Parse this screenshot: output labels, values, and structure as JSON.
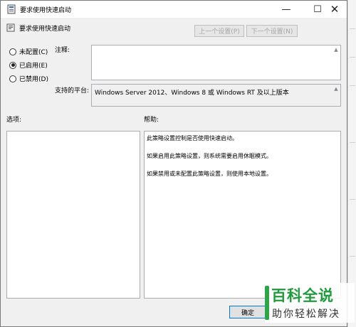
{
  "window": {
    "title": "要求使用快速启动",
    "minimize_glyph": "—",
    "maximize_glyph": "☐",
    "close_glyph": "✕"
  },
  "header": {
    "policy_name": "要求使用快速启动",
    "prev_setting_label": "上一个设置(P)",
    "next_setting_label": "下一个设置(N)"
  },
  "state": {
    "options": [
      {
        "label": "未配置(C)",
        "selected": false
      },
      {
        "label": "已启用(E)",
        "selected": true
      },
      {
        "label": "已禁用(D)",
        "selected": false
      }
    ]
  },
  "comment": {
    "label": "注释:",
    "value": ""
  },
  "platform": {
    "label": "支持的平台:",
    "value": "Windows Server 2012、Windows 8 或 Windows RT 及以上版本"
  },
  "options_panel": {
    "label": "选项:"
  },
  "help_panel": {
    "label": "帮助:",
    "paragraphs": [
      "此策略设置控制是否使用快速启动。",
      "如果启用此策略设置，则系统需要启用休眠模式。",
      "如果禁用或未配置此策略设置，则使用本地设置。"
    ]
  },
  "footer": {
    "ok_label": "确定"
  },
  "watermark": {
    "title": "百科全说",
    "subtitle": "助你轻松解决"
  },
  "colors": {
    "accent": "#0078d7",
    "watermark_green": "#1f9b3c"
  },
  "icons": [
    "policy-icon",
    "minimize-icon",
    "maximize-icon",
    "close-icon",
    "radio-icon"
  ]
}
